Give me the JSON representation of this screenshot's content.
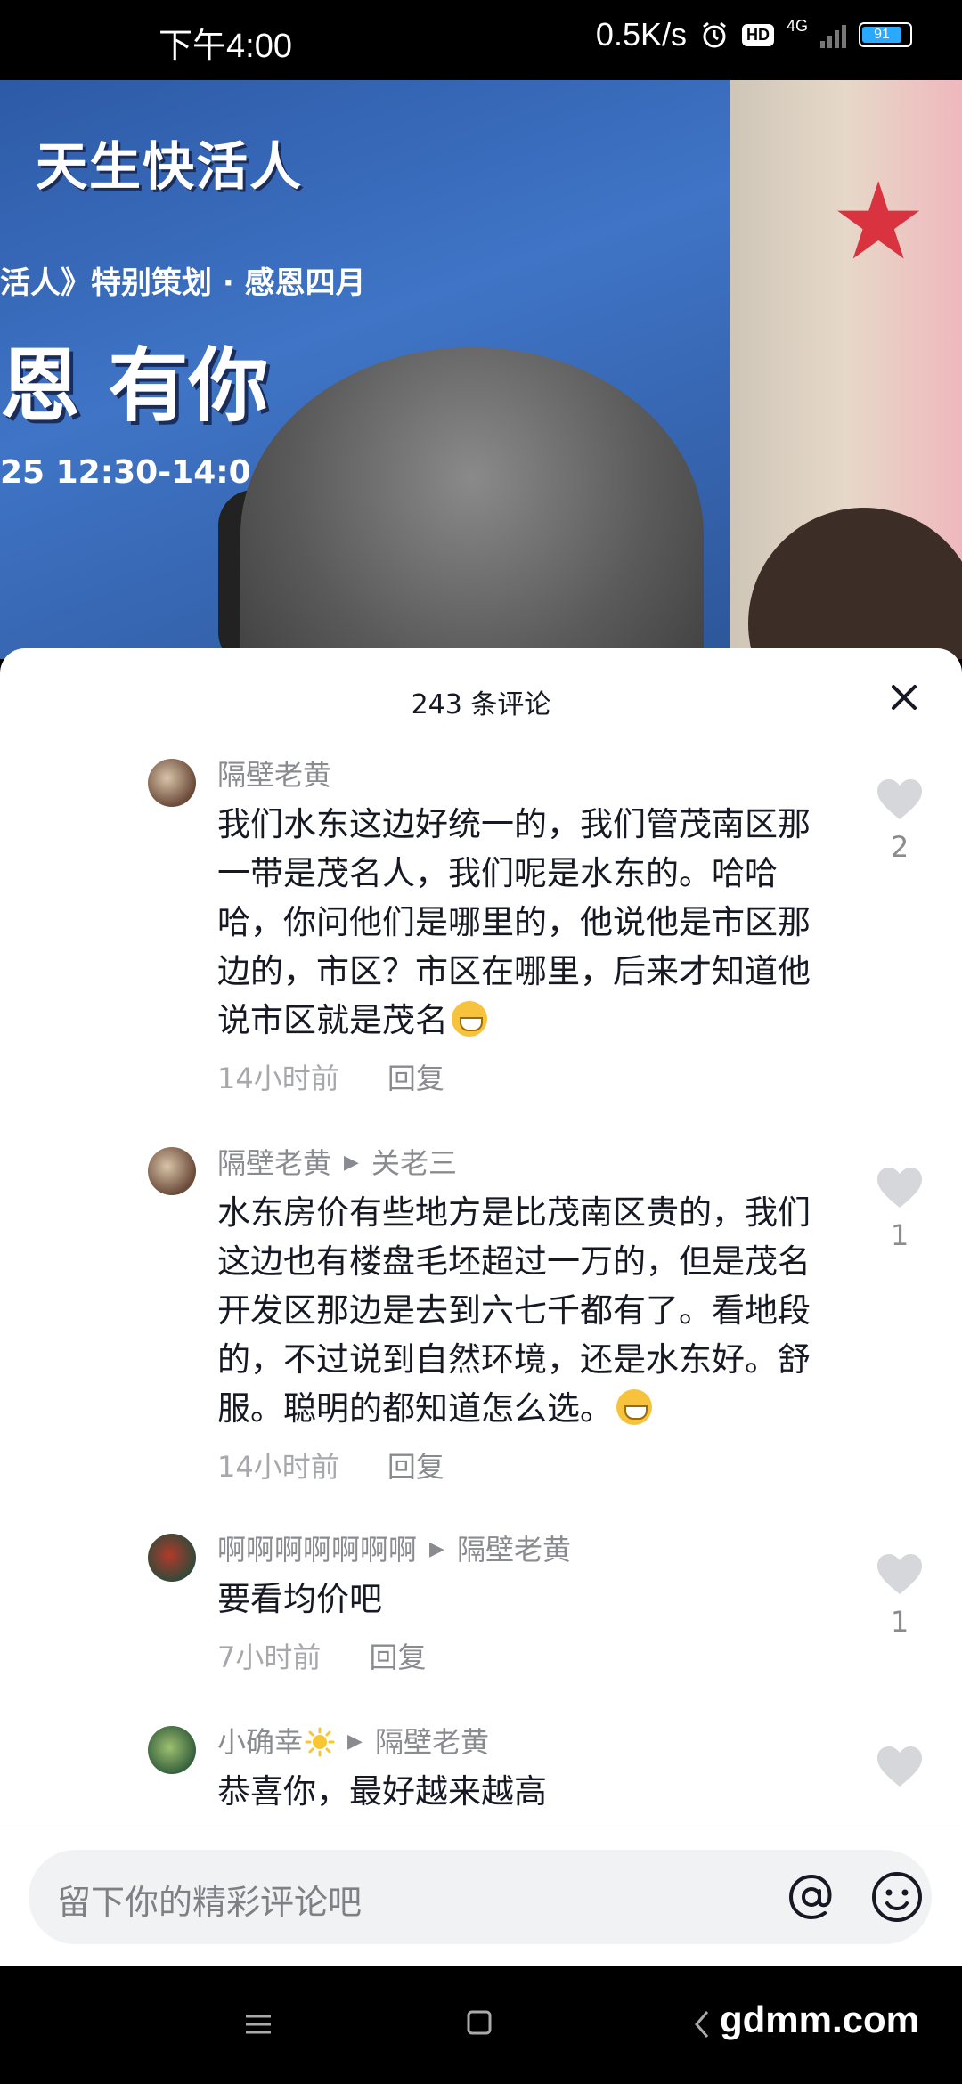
{
  "status": {
    "time": "下午4:00",
    "speed": "0.5K/s",
    "hd": "HD",
    "network": "4G",
    "battery": "91",
    "battery_level": 0.91
  },
  "video": {
    "logo": "天生快活人",
    "line1": "活人》特别策划 · 感恩四月",
    "line2": "恩  有你",
    "line3": "25  12:30-14:0"
  },
  "comments_panel": {
    "count_label": "243 条评论",
    "items": [
      {
        "user": "隔壁老黄",
        "reply_to": "",
        "text": "我们水东这边好统一的，我们管茂南区那一带是茂名人，我们呢是水东的。哈哈哈，你问他们是哪里的，他说他是市区那边的，市区？市区在哪里，后来才知道他说市区就是茂名",
        "time": "14小时前",
        "reply_label": "回复",
        "likes": "2"
      },
      {
        "user": "隔壁老黄",
        "reply_to": "关老三",
        "text": "水东房价有些地方是比茂南区贵的，我们这边也有楼盘毛坯超过一万的，但是茂名开发区那边是去到六七千都有了。看地段的，不过说到自然环境，还是水东好。舒服。聪明的都知道怎么选。",
        "time": "14小时前",
        "reply_label": "回复",
        "likes": "1"
      },
      {
        "user": "啊啊啊啊啊啊啊",
        "reply_to": "隔壁老黄",
        "text": "要看均价吧",
        "time": "7小时前",
        "reply_label": "回复",
        "likes": "1"
      },
      {
        "user": "小确幸",
        "reply_to": "隔壁老黄",
        "text": "恭喜你，最好越来越高",
        "time": "",
        "reply_label": "",
        "likes": ""
      }
    ]
  },
  "input": {
    "placeholder": "留下你的精彩评论吧"
  },
  "watermark": "gdmm.com"
}
